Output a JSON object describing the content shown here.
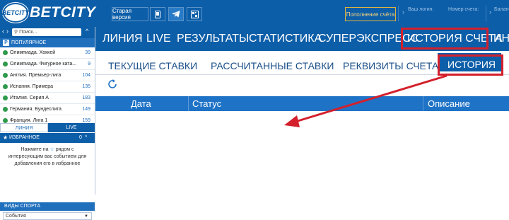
{
  "header": {
    "logo_badge": "BETCITY",
    "logo_text": "BETCITY",
    "old_version": "Старая версия",
    "top_up": "Пополнение счёта",
    "login_label": "Ваш логин:",
    "login_value": "",
    "account_label": "Номер счета:",
    "account_value": "",
    "balance_label": "Баланс",
    "balance_value": ""
  },
  "sidebar": {
    "search_placeholder": "Поиск...",
    "popular": "ПОПУЛЯРНОЕ",
    "sports": [
      {
        "label": "Олимпиада. Хоккей",
        "count": "39"
      },
      {
        "label": "Олимпиада. Фигурное ката...",
        "count": "9"
      },
      {
        "label": "Англия. Премьер-лига",
        "count": "104"
      },
      {
        "label": "Испания. Примера",
        "count": "135"
      },
      {
        "label": "Италия. Серия А",
        "count": "183"
      },
      {
        "label": "Германия. Бундеслига",
        "count": "149"
      },
      {
        "label": "Франция. Лига 1",
        "count": "159"
      }
    ],
    "tab_line": "ЛИНИЯ",
    "tab_live": "LIVE",
    "favorites": "ИЗБРАННОЕ",
    "favorites_count": "0",
    "fav_text_1": "Нажмите на",
    "fav_text_1b": "рядом с",
    "fav_text_2": "интересующим вас событием для",
    "fav_text_3": "добавления его в избранное",
    "sport_types": "ВИДЫ СПОРТА",
    "events_select": "События"
  },
  "nav": {
    "items": [
      "ЛИНИЯ",
      "LIVE",
      "РЕЗУЛЬТАТЫ",
      "СТАТИСТИКА",
      "СУПЕРЭКСПРЕСС",
      "ИСТОРИЯ СЧЕТА",
      "ИНС"
    ]
  },
  "subnav": {
    "items": [
      "ТЕКУЩИЕ СТАВКИ",
      "РАССЧИТАННЫЕ СТАВКИ",
      "РЕКВИЗИТЫ СЧЕТА",
      "ИСТОРИЯ"
    ]
  },
  "table": {
    "headers": [
      "Дата",
      "Статус",
      "Описание"
    ]
  },
  "colors": {
    "brand_blue": "#0d5ea8",
    "highlight_red": "#d3202c"
  }
}
